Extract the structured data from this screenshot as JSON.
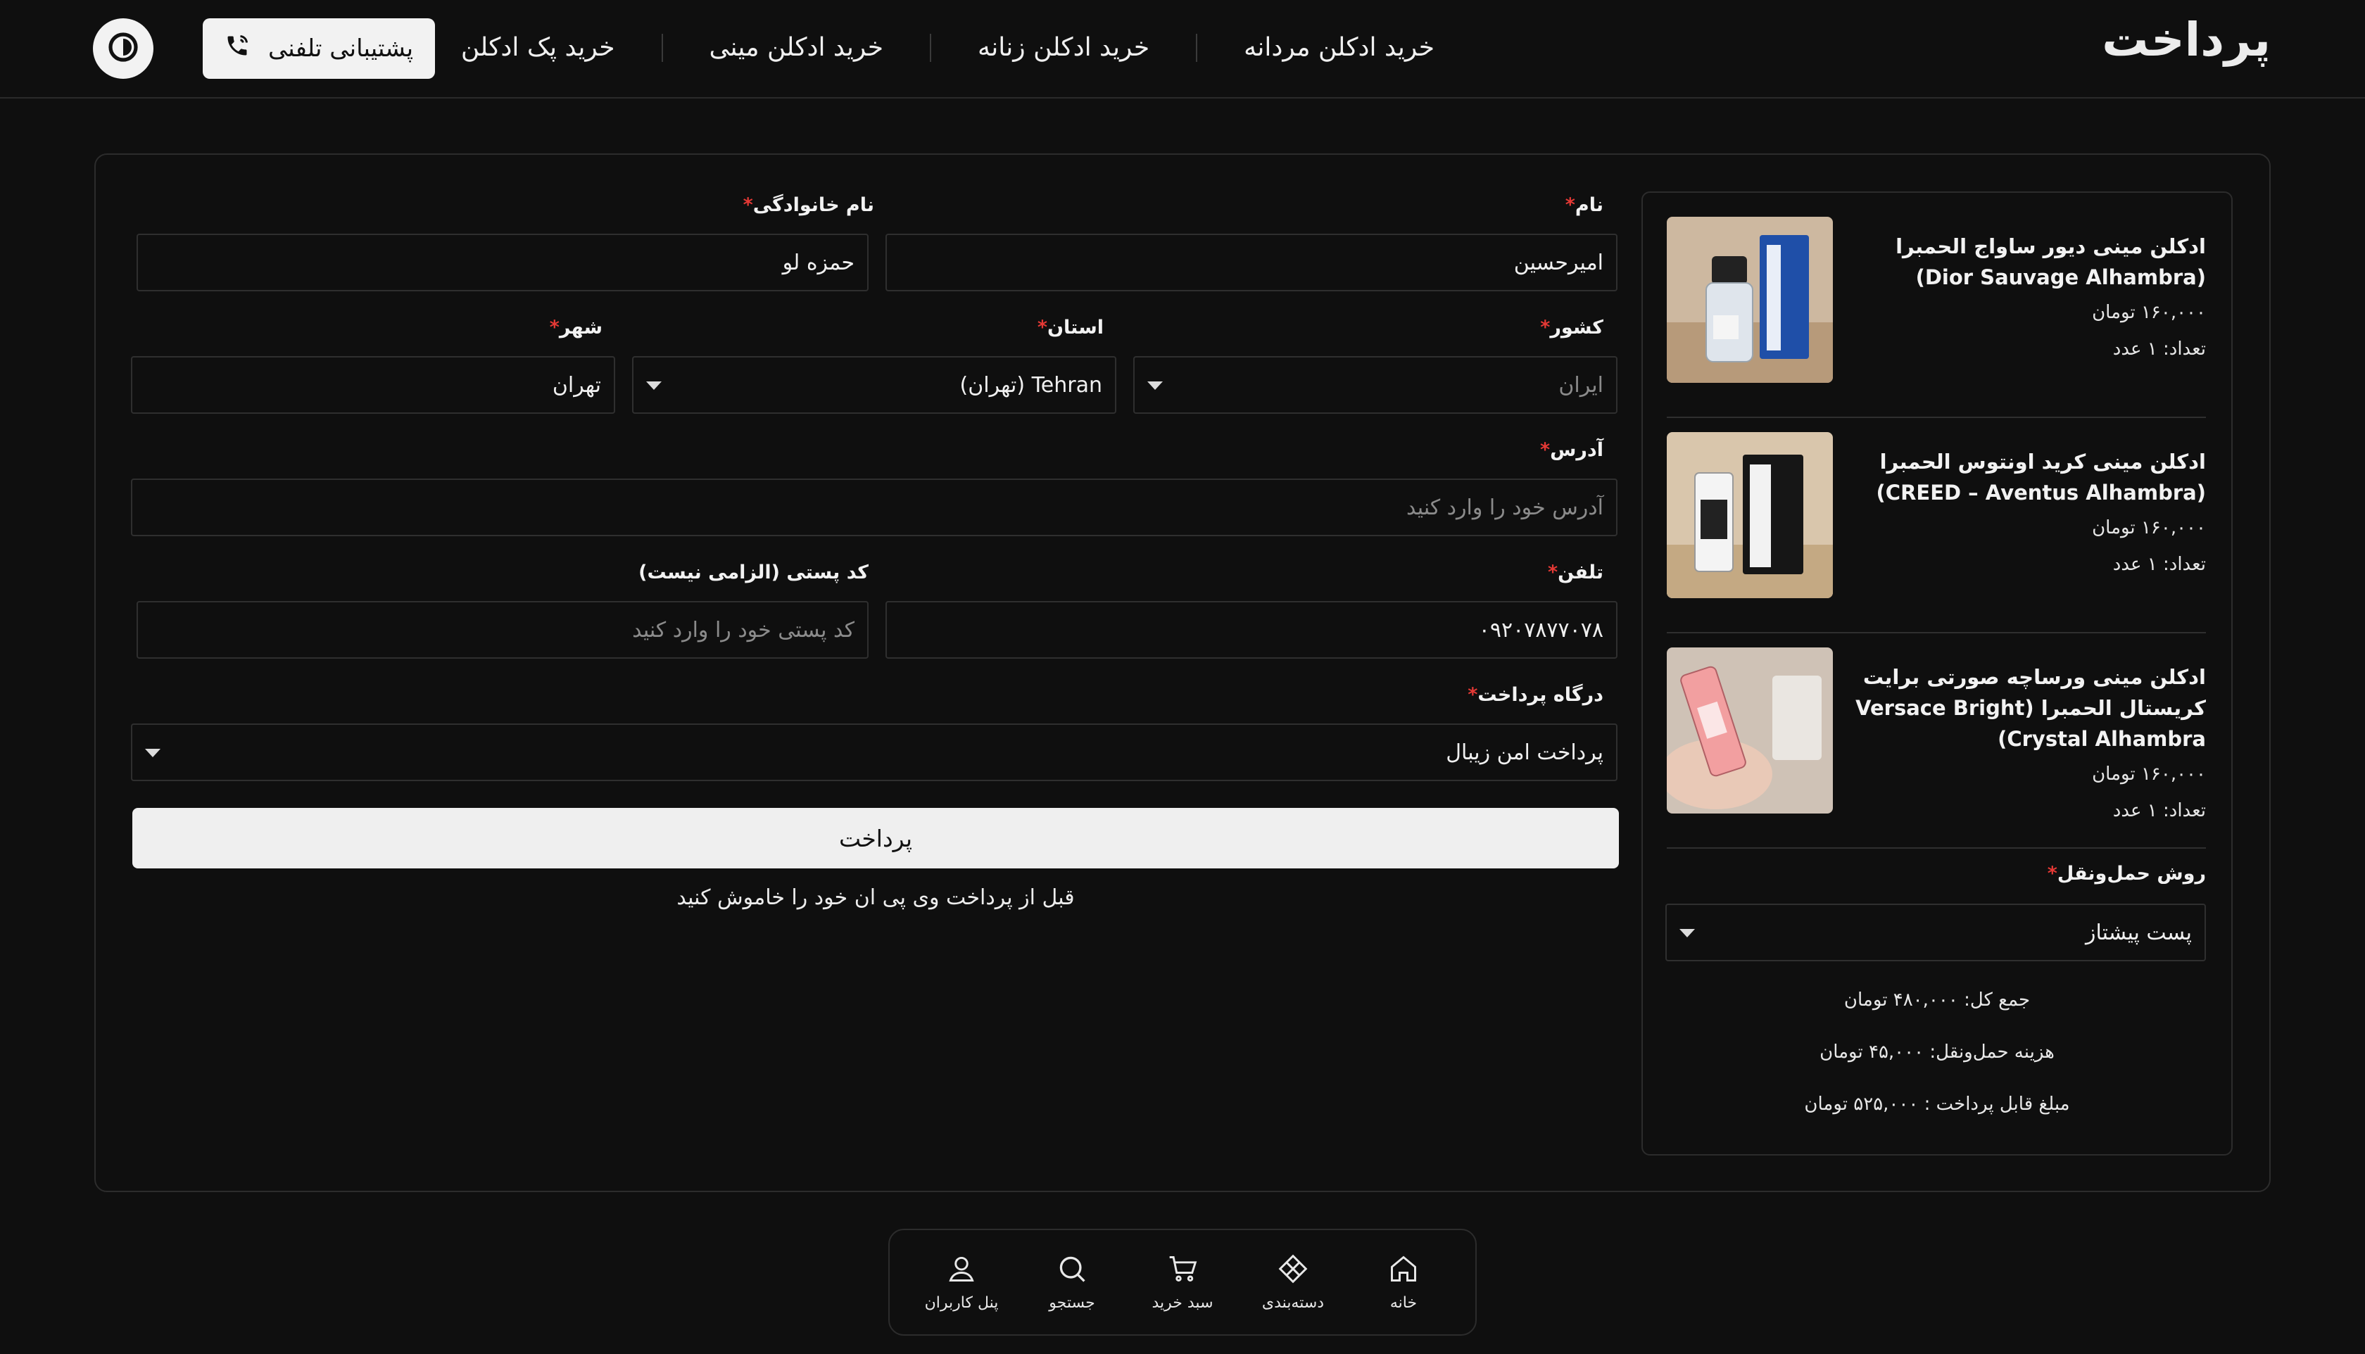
{
  "header": {
    "title": "پرداخت",
    "nav": [
      "خرید ادکلن مردانه",
      "خرید ادکلن زنانه",
      "خرید ادکلن مینی",
      "خرید پک ادکلن"
    ],
    "support_label": "پشتیبانی تلفنی"
  },
  "cart": {
    "items": [
      {
        "name": "ادکلن مینی دیور ساواج الحمبرا (Dior Sauvage Alhambra)",
        "price": "۱۶۰,۰۰۰ تومان",
        "qty": "تعداد: ۱ عدد"
      },
      {
        "name": "ادکلن مینی کرید اونتوس الحمبرا (CREED – Aventus Alhambra)",
        "price": "۱۶۰,۰۰۰ تومان",
        "qty": "تعداد: ۱ عدد"
      },
      {
        "name": "ادکلن مینی ورساچه صورتی برایت کریستال الحمبرا (Versace Bright Crystal Alhambra)",
        "price": "۱۶۰,۰۰۰ تومان",
        "qty": "تعداد: ۱ عدد"
      }
    ],
    "shipping_label": "روش حمل‌ونقل",
    "shipping_value": "پست پیشتاز",
    "total": "جمع کل: ۴۸۰,۰۰۰ تومان",
    "shipping_cost": "هزینه حمل‌ونقل: ۴۵,۰۰۰ تومان",
    "payable": "مبلغ قابل پرداخت : ۵۲۵,۰۰۰ تومان"
  },
  "form": {
    "first_name_label": "نام",
    "first_name_value": "امیرحسین",
    "last_name_label": "نام خانوادگی",
    "last_name_value": "حمزه لو",
    "country_label": "کشور",
    "country_value": "ایران",
    "province_label": "استان",
    "province_value": "Tehran (تهران)",
    "city_label": "شهر",
    "city_value": "تهران",
    "address_label": "آدرس",
    "address_placeholder": "آدرس خود را وارد کنید",
    "phone_label": "تلفن",
    "phone_value": "۰۹۲۰۷۸۷۷۰۷۸",
    "postal_label": "کد پستی (الزامی نیست)",
    "postal_placeholder": "کد پستی خود را وارد کنید",
    "gateway_label": "درگاه پرداخت",
    "gateway_value": "پرداخت امن زیبال",
    "pay_button": "پرداخت",
    "vpn_note": "قبل از پرداخت وی پی ان خود را خاموش کنید"
  },
  "bottom_nav": [
    {
      "label": "خانه",
      "icon": "home-icon"
    },
    {
      "label": "دسته‌بندی",
      "icon": "category-icon"
    },
    {
      "label": "سبد خرید",
      "icon": "cart-icon"
    },
    {
      "label": "جستجو",
      "icon": "search-icon"
    },
    {
      "label": "پنل کاربران",
      "icon": "user-icon"
    }
  ]
}
